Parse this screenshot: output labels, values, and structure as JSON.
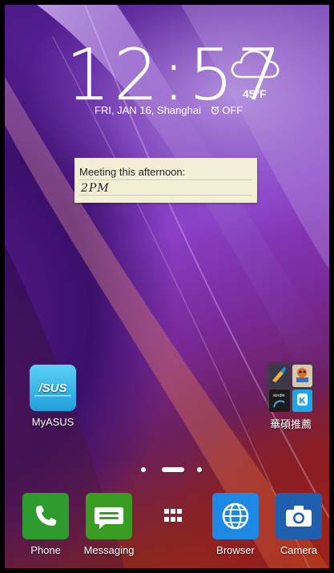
{
  "lockscreen_clock": {
    "time": "12:57",
    "temperature": "45°F",
    "date_location": "FRI, JAN 16, Shanghai",
    "alarm": "OFF",
    "weather_icon": "cloud-icon"
  },
  "memo_widget": {
    "line1": "Meeting this afternoon:",
    "line2": "2PM"
  },
  "home_apps": [
    {
      "label": "MyASUS",
      "icon": "asus-logo-icon"
    },
    {
      "label": "華碩推薦",
      "icon": "folder-icon"
    }
  ],
  "folder_contents": [
    "cleaner-icon",
    "game-icon",
    "kindle-icon",
    "k-app-icon"
  ],
  "page_indicator": {
    "pages": 3,
    "current": 2
  },
  "dock": [
    {
      "label": "Phone",
      "icon": "phone-icon",
      "color": "#2e9b2e"
    },
    {
      "label": "Messaging",
      "icon": "message-icon",
      "color": "#3a9d23"
    },
    {
      "label": "",
      "icon": "app-drawer-icon",
      "color": "#ffffff"
    },
    {
      "label": "Browser",
      "icon": "globe-icon",
      "color": "#1e88e5"
    },
    {
      "label": "Camera",
      "icon": "camera-icon",
      "color": "#1f5fb0"
    }
  ]
}
